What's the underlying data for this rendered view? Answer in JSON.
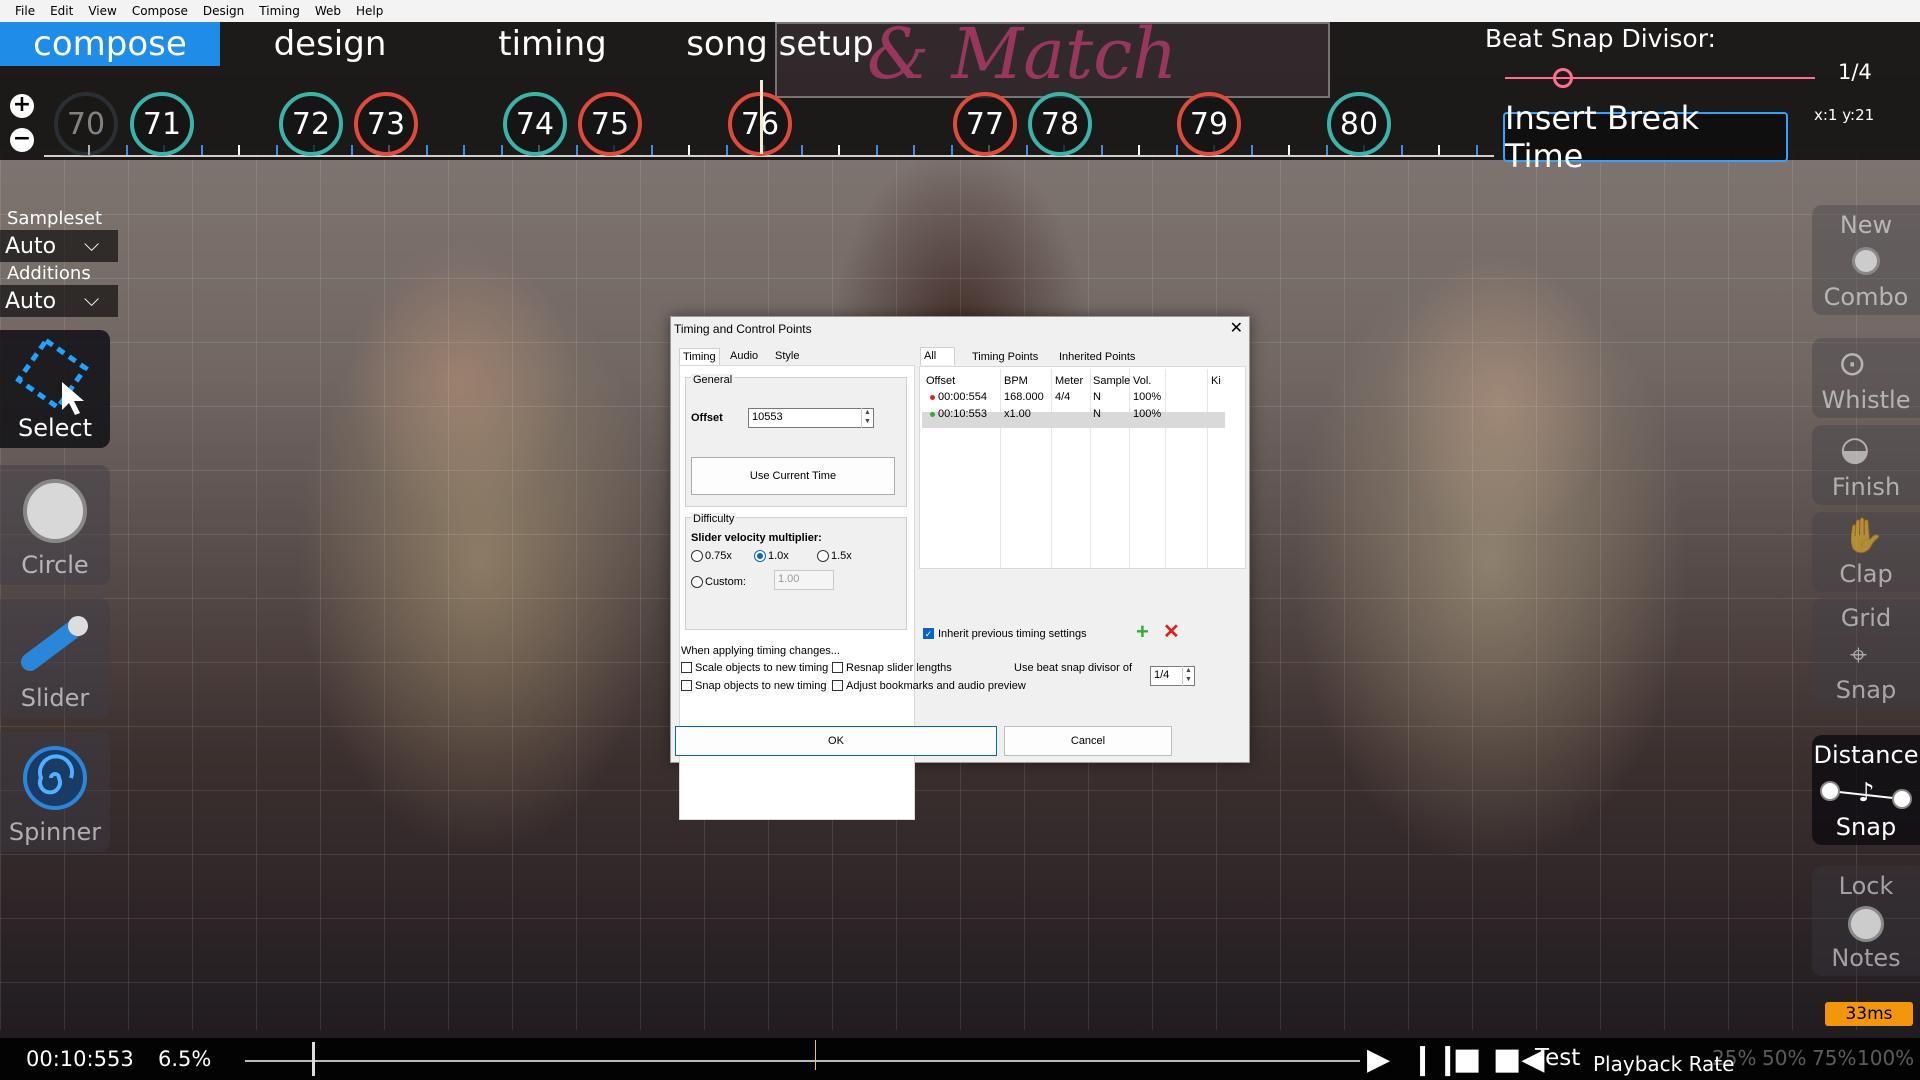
{
  "menu": [
    "File",
    "Edit",
    "View",
    "Compose",
    "Design",
    "Timing",
    "Web",
    "Help"
  ],
  "modes": {
    "compose": "compose",
    "design": "design",
    "timing": "timing",
    "song_setup": "song setup"
  },
  "background_title": "& Match",
  "timeline": {
    "circles": [
      {
        "n": "70",
        "color": "#3a4a55",
        "faded": true
      },
      {
        "n": "71",
        "color": "#3bb3a8"
      },
      {
        "n": "72",
        "color": "#3bb3a8"
      },
      {
        "n": "73",
        "color": "#e04a3a"
      },
      {
        "n": "74",
        "color": "#3bb3a8"
      },
      {
        "n": "75",
        "color": "#e04a3a"
      },
      {
        "n": "76",
        "color": "#e04a3a"
      },
      {
        "n": "77",
        "color": "#e04a3a"
      },
      {
        "n": "78",
        "color": "#3bb3a8"
      },
      {
        "n": "79",
        "color": "#e04a3a"
      },
      {
        "n": "80",
        "color": "#3bb3a8"
      }
    ]
  },
  "beat_snap": {
    "label": "Beat Snap Divisor:",
    "value": "1/4"
  },
  "insert_break": "Insert Break Time",
  "coords": "x:1 y:21",
  "left_panel": {
    "sampleset_label": "Sampleset",
    "sampleset_value": "Auto",
    "additions_label": "Additions",
    "additions_value": "Auto",
    "tools": {
      "select": "Select",
      "circle": "Circle",
      "slider": "Slider",
      "spinner": "Spinner"
    }
  },
  "right_panel": {
    "new": "New",
    "combo": "Combo",
    "whistle": "Whistle",
    "finish": "Finish",
    "clap": "Clap",
    "grid": "Grid",
    "snap": "Snap",
    "distance": "Distance",
    "distance_snap": "Snap",
    "lock": "Lock",
    "notes": "Notes",
    "latency": "33ms"
  },
  "bottom": {
    "time": "00:10:553",
    "percent": "6.5%",
    "progress": 0.065,
    "test": "Test",
    "playback_rate": "Playback Rate",
    "rates": [
      "25%",
      "50%",
      "75%",
      "100%"
    ]
  },
  "dialog": {
    "title": "Timing and Control Points",
    "tabs": [
      "Timing",
      "Audio",
      "Style"
    ],
    "general": "General",
    "offset_label": "Offset",
    "offset_value": "10553",
    "use_current_time": "Use Current Time",
    "difficulty": "Difficulty",
    "sv_label": "Slider velocity multiplier:",
    "sv_options": [
      "0.75x",
      "1.0x",
      "1.5x"
    ],
    "sv_selected": "1.0x",
    "custom_label": "Custom:",
    "custom_value": "1.00",
    "list_tabs": [
      "All",
      "Timing Points",
      "Inherited Points"
    ],
    "columns": [
      "Offset",
      "BPM",
      "Meter",
      "Sample",
      "Vol.",
      "Ki"
    ],
    "rows": [
      {
        "offset": "00:00:554",
        "bpm": "168.000",
        "meter": "4/4",
        "sample": "N",
        "vol": "100%",
        "color": "#d42a2a"
      },
      {
        "offset": "00:10:553",
        "bpm": "x1.00",
        "meter": "",
        "sample": "N",
        "vol": "100%",
        "color": "#2fae2f"
      }
    ],
    "inherit_label": "Inherit previous timing settings",
    "applying_label": "When applying timing changes...",
    "scale_objects": "Scale objects to new timing",
    "snap_objects": "Snap objects to new timing",
    "resnap_sliders": "Resnap slider lengths",
    "adjust_bookmarks": "Adjust bookmarks and audio preview",
    "beat_snap_label": "Use beat snap divisor of",
    "beat_snap_value": "1/4",
    "ok": "OK",
    "cancel": "Cancel"
  }
}
